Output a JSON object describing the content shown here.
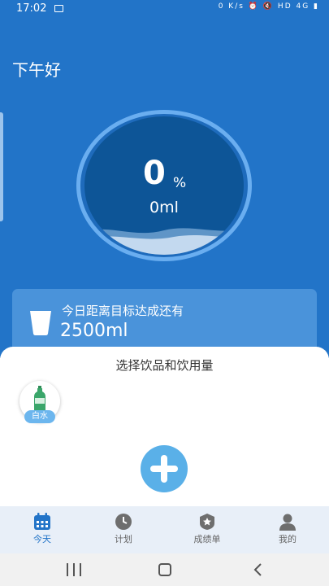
{
  "status_bar": {
    "time": "17:02",
    "icons_right": "0 K/s ⏰ 🔇 HD 4G ▮",
    "icons": [
      "image-icon",
      "alarm-icon",
      "mute-icon",
      "signal-icon",
      "battery-icon"
    ]
  },
  "greeting": "下午好",
  "progress": {
    "percent_value": "0",
    "percent_sign": "%",
    "ml_text": "0ml",
    "fill_fraction": 0
  },
  "goal_card": {
    "label": "今日距离目标达成还有",
    "amount": "2500ml"
  },
  "drink_sheet": {
    "title": "选择饮品和饮用量",
    "drinks": [
      {
        "label": "白水",
        "icon": "water-bottle-icon"
      }
    ],
    "add_icon": "plus-icon"
  },
  "tabs": [
    {
      "label": "今天",
      "icon": "calendar-icon",
      "active": true
    },
    {
      "label": "计划",
      "icon": "clock-icon",
      "active": false
    },
    {
      "label": "成绩单",
      "icon": "medal-icon",
      "active": false
    },
    {
      "label": "我的",
      "icon": "user-icon",
      "active": false
    }
  ],
  "colors": {
    "primary": "#2274c8",
    "accent": "#5ab0e8",
    "active_tab": "#2274c8",
    "inactive_tab": "#666666"
  }
}
